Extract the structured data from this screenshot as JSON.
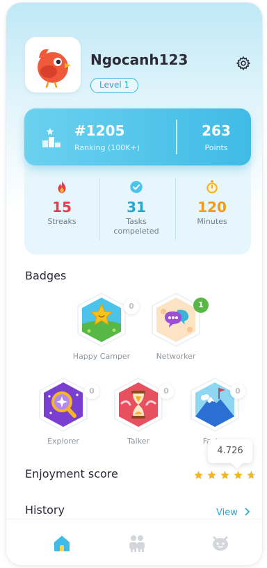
{
  "profile": {
    "username": "Ngocanh123",
    "level": "Level 1",
    "avatar": "red-bird-avatar",
    "settings_icon": "gear-icon"
  },
  "stats": {
    "ranking_value": "#1205",
    "ranking_label": "Ranking (100K+)",
    "points_value": "263",
    "points_label": "Points",
    "metrics": [
      {
        "icon": "flame-icon",
        "value": "15",
        "label": "Streaks",
        "color": "#e43d4e"
      },
      {
        "icon": "check-circle-icon",
        "value": "31",
        "label": "Tasks compeleted",
        "color": "#2aa6cc"
      },
      {
        "icon": "stopwatch-icon",
        "value": "120",
        "label": "Minutes",
        "color": "#f39a16"
      }
    ]
  },
  "badges": {
    "title": "Badges",
    "items": [
      {
        "name": "Happy Camper",
        "count": "0",
        "icon": "star-meadow-badge-icon"
      },
      {
        "name": "Networker",
        "count": "1",
        "icon": "chat-bubbles-badge-icon"
      },
      {
        "name": "Explorer",
        "count": "0",
        "icon": "magnifier-badge-icon"
      },
      {
        "name": "Talker",
        "count": "0",
        "icon": "hourglass-badge-icon"
      },
      {
        "name": "Fastes",
        "count": "0",
        "icon": "mountain-flag-badge-icon"
      }
    ]
  },
  "enjoyment": {
    "title": "Enjoyment score",
    "score": "4.726",
    "rating": 4.726,
    "max": 5
  },
  "history": {
    "title": "History",
    "view_label": "View"
  },
  "nav": {
    "items": [
      {
        "icon": "home-icon",
        "active": true
      },
      {
        "icon": "friends-icon",
        "active": false
      },
      {
        "icon": "pet-face-icon",
        "active": false
      }
    ]
  },
  "colors": {
    "accent": "#2aa6cc",
    "card_gradient_start": "#6bd1ef",
    "card_gradient_end": "#3fbbe6",
    "star": "#f6b621"
  }
}
